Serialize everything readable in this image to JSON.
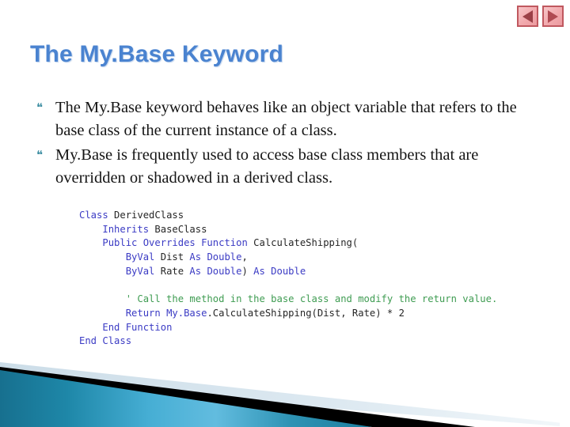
{
  "slide": {
    "title": "The My.Base Keyword",
    "bullet_glyph": "❝",
    "bullets": [
      "The My.Base keyword behaves like an object variable that refers to the base class of the current instance of a class.",
      "My.Base is frequently used to access base class members that are overridden or shadowed in a derived class."
    ]
  },
  "navigation": {
    "previous_label": "Previous slide",
    "next_label": "Next slide",
    "previous_icon": "triangle-left-icon",
    "next_icon": "triangle-right-icon"
  },
  "code_block": {
    "language": "Visual Basic .NET",
    "lines": [
      {
        "indent": 0,
        "tokens": [
          {
            "t": "Class ",
            "c": "kw"
          },
          {
            "t": "DerivedClass",
            "c": "id"
          }
        ]
      },
      {
        "indent": 1,
        "tokens": [
          {
            "t": "Inherits ",
            "c": "kw"
          },
          {
            "t": "BaseClass",
            "c": "id"
          }
        ]
      },
      {
        "indent": 1,
        "tokens": [
          {
            "t": "Public Overrides Function ",
            "c": "kw"
          },
          {
            "t": "CalculateShipping(",
            "c": "id"
          }
        ]
      },
      {
        "indent": 2,
        "tokens": [
          {
            "t": "ByVal ",
            "c": "kw"
          },
          {
            "t": "Dist ",
            "c": "id"
          },
          {
            "t": "As ",
            "c": "kw"
          },
          {
            "t": "Double",
            "c": "kw"
          },
          {
            "t": ",",
            "c": "id"
          }
        ]
      },
      {
        "indent": 2,
        "tokens": [
          {
            "t": "ByVal ",
            "c": "kw"
          },
          {
            "t": "Rate ",
            "c": "id"
          },
          {
            "t": "As ",
            "c": "kw"
          },
          {
            "t": "Double",
            "c": "kw"
          },
          {
            "t": ") ",
            "c": "id"
          },
          {
            "t": "As ",
            "c": "kw"
          },
          {
            "t": "Double",
            "c": "kw"
          }
        ]
      },
      {
        "indent": 0,
        "tokens": []
      },
      {
        "indent": 2,
        "tokens": [
          {
            "t": "' Call the method in the base class and modify the return value.",
            "c": "cm"
          }
        ]
      },
      {
        "indent": 2,
        "tokens": [
          {
            "t": "Return ",
            "c": "kw"
          },
          {
            "t": "My.Base",
            "c": "kw"
          },
          {
            "t": ".CalculateShipping(Dist, Rate) * 2",
            "c": "id"
          }
        ]
      },
      {
        "indent": 1,
        "tokens": [
          {
            "t": "End Function",
            "c": "kw"
          }
        ]
      },
      {
        "indent": 0,
        "tokens": [
          {
            "t": "End Class",
            "c": "kw"
          }
        ]
      }
    ]
  },
  "theme": {
    "title_color": "#4a83d0",
    "bullet_color": "#3f8fa3",
    "keyword_color": "#3b3bc4",
    "comment_color": "#3f9c52",
    "accent_teal_dark": "#1b7e9e",
    "accent_teal_light": "#62bcdf",
    "accent_pale": "#dce9f0",
    "accent_black": "#000000",
    "nav_button_fill": "#f2a9ad",
    "nav_button_border": "#c0585f",
    "background": "#ffffff"
  }
}
